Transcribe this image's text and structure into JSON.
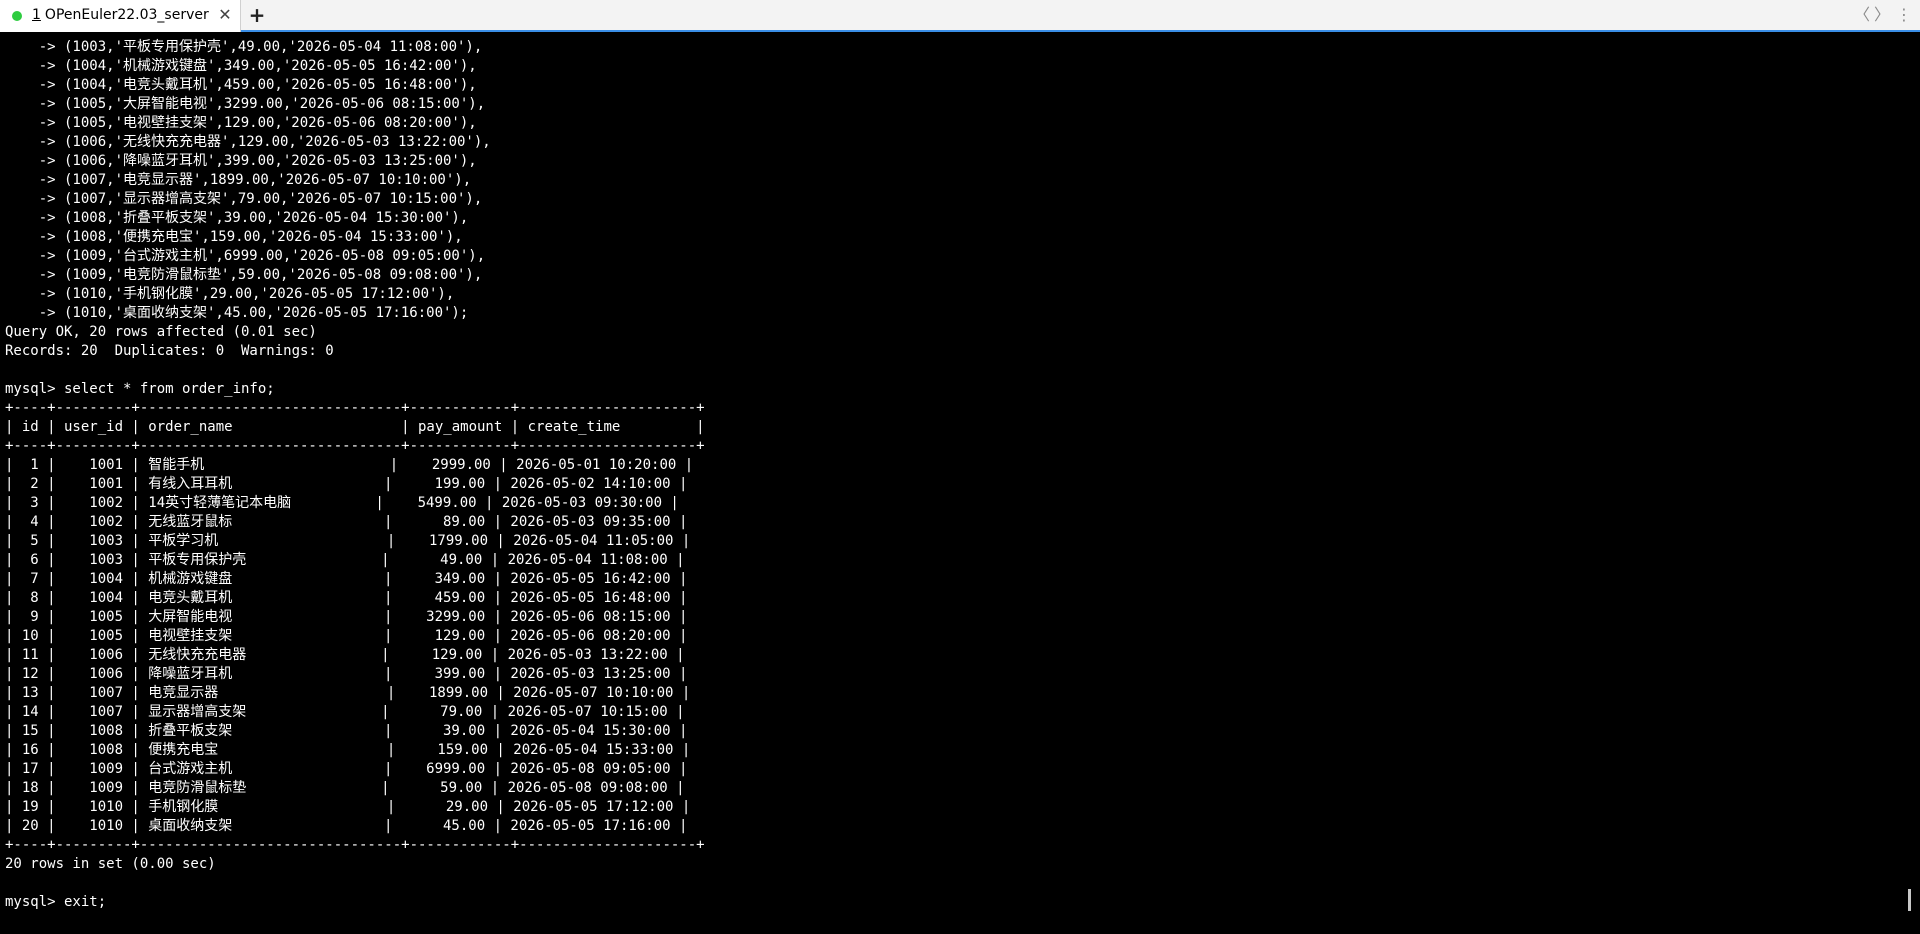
{
  "tab": {
    "number": "1",
    "title": "OPenEuler22.03_server",
    "close_glyph": "✕",
    "status_color": "#2ecc40"
  },
  "tabbar": {
    "add_glyph": "+",
    "prev_glyph": "〈",
    "next_glyph": "〉",
    "menu_glyph": "⋮"
  },
  "terminal": {
    "lines": [
      "    -> (1003,'平板专用保护壳',49.00,'2026-05-04 11:08:00'),",
      "    -> (1004,'机械游戏键盘',349.00,'2026-05-05 16:42:00'),",
      "    -> (1004,'电竞头戴耳机',459.00,'2026-05-05 16:48:00'),",
      "    -> (1005,'大屏智能电视',3299.00,'2026-05-06 08:15:00'),",
      "    -> (1005,'电视壁挂支架',129.00,'2026-05-06 08:20:00'),",
      "    -> (1006,'无线快充充电器',129.00,'2026-05-03 13:22:00'),",
      "    -> (1006,'降噪蓝牙耳机',399.00,'2026-05-03 13:25:00'),",
      "    -> (1007,'电竞显示器',1899.00,'2026-05-07 10:10:00'),",
      "    -> (1007,'显示器增高支架',79.00,'2026-05-07 10:15:00'),",
      "    -> (1008,'折叠平板支架',39.00,'2026-05-04 15:30:00'),",
      "    -> (1008,'便携充电宝',159.00,'2026-05-04 15:33:00'),",
      "    -> (1009,'台式游戏主机',6999.00,'2026-05-08 09:05:00'),",
      "    -> (1009,'电竞防滑鼠标垫',59.00,'2026-05-08 09:08:00'),",
      "    -> (1010,'手机钢化膜',29.00,'2026-05-05 17:12:00'),",
      "    -> (1010,'桌面收纳支架',45.00,'2026-05-05 17:16:00');",
      "Query OK, 20 rows affected (0.01 sec)",
      "Records: 20  Duplicates: 0  Warnings: 0",
      "",
      "mysql> select * from order_info;",
      "+----+---------+-------------------------------+------------+---------------------+",
      "| id | user_id | order_name                    | pay_amount | create_time         |",
      "+----+---------+-------------------------------+------------+---------------------+",
      "|  1 |    1001 | 智能手机                      |    2999.00 | 2026-05-01 10:20:00 |",
      "|  2 |    1001 | 有线入耳耳机                  |     199.00 | 2026-05-02 14:10:00 |",
      "|  3 |    1002 | 14英寸轻薄笔记本电脑          |    5499.00 | 2026-05-03 09:30:00 |",
      "|  4 |    1002 | 无线蓝牙鼠标                  |      89.00 | 2026-05-03 09:35:00 |",
      "|  5 |    1003 | 平板学习机                    |    1799.00 | 2026-05-04 11:05:00 |",
      "|  6 |    1003 | 平板专用保护壳                |      49.00 | 2026-05-04 11:08:00 |",
      "|  7 |    1004 | 机械游戏键盘                  |     349.00 | 2026-05-05 16:42:00 |",
      "|  8 |    1004 | 电竞头戴耳机                  |     459.00 | 2026-05-05 16:48:00 |",
      "|  9 |    1005 | 大屏智能电视                  |    3299.00 | 2026-05-06 08:15:00 |",
      "| 10 |    1005 | 电视壁挂支架                  |     129.00 | 2026-05-06 08:20:00 |",
      "| 11 |    1006 | 无线快充充电器                |     129.00 | 2026-05-03 13:22:00 |",
      "| 12 |    1006 | 降噪蓝牙耳机                  |     399.00 | 2026-05-03 13:25:00 |",
      "| 13 |    1007 | 电竞显示器                    |    1899.00 | 2026-05-07 10:10:00 |",
      "| 14 |    1007 | 显示器增高支架                |      79.00 | 2026-05-07 10:15:00 |",
      "| 15 |    1008 | 折叠平板支架                  |      39.00 | 2026-05-04 15:30:00 |",
      "| 16 |    1008 | 便携充电宝                    |     159.00 | 2026-05-04 15:33:00 |",
      "| 17 |    1009 | 台式游戏主机                  |    6999.00 | 2026-05-08 09:05:00 |",
      "| 18 |    1009 | 电竞防滑鼠标垫                |      59.00 | 2026-05-08 09:08:00 |",
      "| 19 |    1010 | 手机钢化膜                    |      29.00 | 2026-05-05 17:12:00 |",
      "| 20 |    1010 | 桌面收纳支架                  |      45.00 | 2026-05-05 17:16:00 |",
      "+----+---------+-------------------------------+------------+---------------------+",
      "20 rows in set (0.00 sec)",
      "",
      "mysql> exit;"
    ]
  }
}
